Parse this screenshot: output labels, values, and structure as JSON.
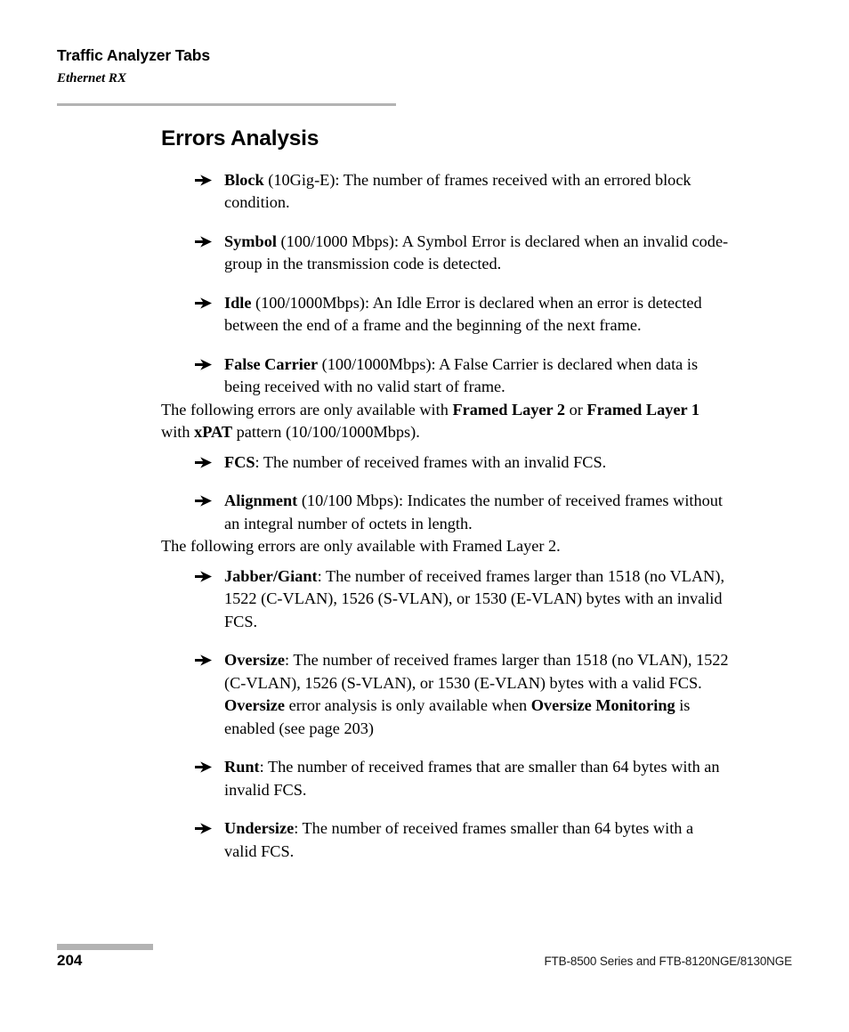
{
  "page": {
    "background_color": "#ffffff",
    "rule_color": "#b3b3b3",
    "text_color": "#000000"
  },
  "header": {
    "title": "Traffic Analyzer Tabs",
    "subtitle": "Ethernet RX"
  },
  "main": {
    "heading": "Errors Analysis",
    "bullets_group_1": [
      {
        "term": "Block",
        "rest": " (10Gig-E): The number of frames received with an errored block condition."
      },
      {
        "term": "Symbol",
        "rest": " (100/1000 Mbps): A Symbol Error is declared when an invalid code-group in the transmission code is detected."
      },
      {
        "term": "Idle",
        "rest": " (100/1000Mbps): An Idle Error is declared when an error is detected between the end of a frame and the beginning of the next frame."
      },
      {
        "term": "False Carrier",
        "rest": " (100/1000Mbps): A False Carrier is declared when data is being received with no valid start of frame."
      }
    ],
    "paragraph_1": {
      "part_1": "The following errors are only available with ",
      "bold_1": "Framed Layer 2",
      "part_2": " or ",
      "bold_2": "Framed Layer 1",
      "part_3": " with ",
      "bold_3": "xPAT",
      "part_4": " pattern (10/100/1000Mbps)."
    },
    "bullets_group_2": [
      {
        "term": "FCS",
        "rest": ": The number of received frames with an invalid FCS."
      },
      {
        "term": "Alignment",
        "rest": " (10/100 Mbps): Indicates the number of received frames without an integral number of octets in length."
      }
    ],
    "paragraph_2": "The following errors are only available with Framed Layer 2.",
    "bullets_group_3": [
      {
        "term": "Jabber/Giant",
        "rest": ": The number of received frames larger than 1518 (no VLAN), 1522 (C-VLAN), 1526 (S-VLAN), or 1530 (E-VLAN) bytes with an invalid FCS."
      },
      {
        "term": "Oversize",
        "rest_1": ": The number of received frames larger than 1518 (no VLAN), 1522 (C-VLAN), 1526 (S-VLAN), or 1530 (E-VLAN) bytes with a valid FCS. ",
        "bold_mid": "Oversize",
        "rest_2": " error analysis is only available when ",
        "bold_end": "Oversize Monitoring",
        "rest_3": " is enabled (see page 203)"
      },
      {
        "term": "Runt",
        "rest": ": The number of received frames that are smaller than 64 bytes with an invalid FCS."
      },
      {
        "term": "Undersize",
        "rest": ": The number of received frames smaller than 64 bytes with a valid FCS."
      }
    ]
  },
  "footer": {
    "page_number": "204",
    "note": "FTB-8500 Series and FTB-8120NGE/8130NGE"
  },
  "icons": {
    "bullet": "arrow-bullet-icon"
  }
}
